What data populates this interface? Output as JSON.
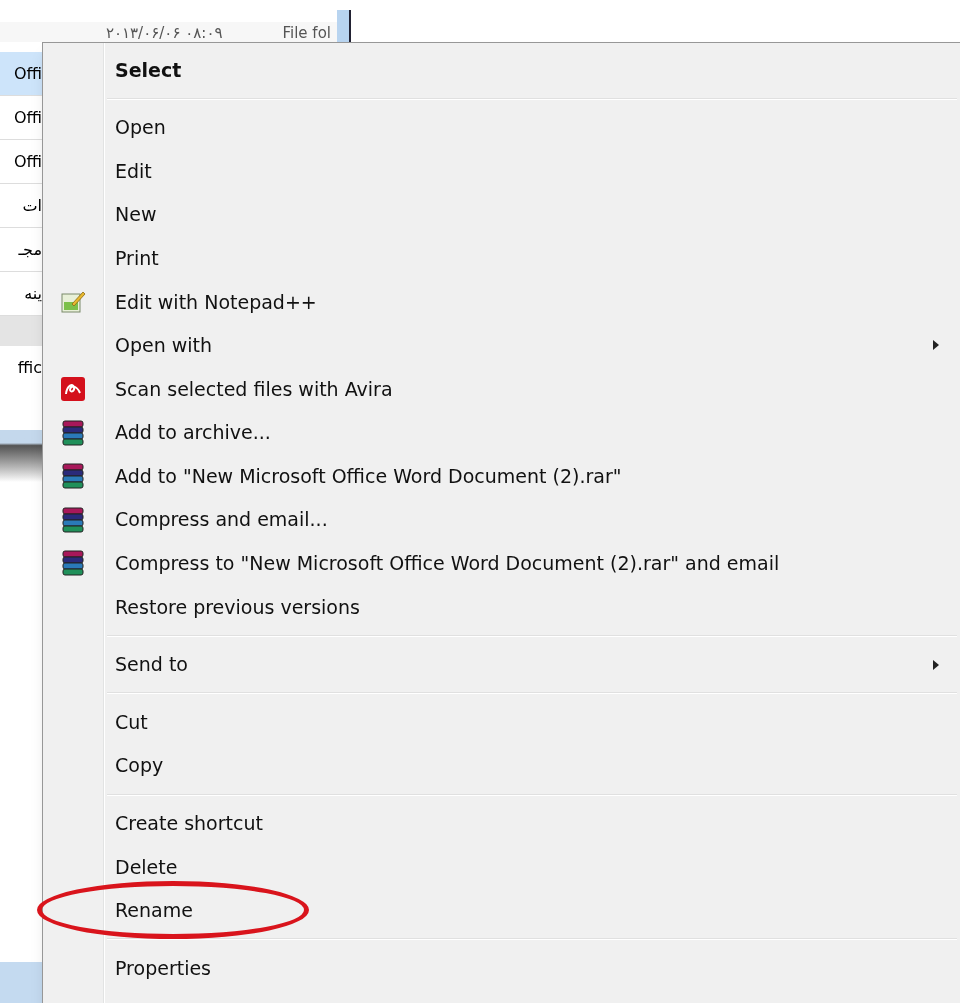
{
  "file_row": {
    "date": "۲۰۱۳/۰۶/۰۶ ۰۸:۰۹",
    "type": "File fol"
  },
  "left_items": [
    {
      "text": "Offi",
      "selected": true
    },
    {
      "text": "Offi",
      "selected": false
    },
    {
      "text": "Offi",
      "selected": false
    },
    {
      "text": "ات",
      "selected": false
    },
    {
      "text": "مجـ",
      "selected": false
    },
    {
      "text": "ينه",
      "selected": false
    }
  ],
  "lower_item": {
    "text": "ffic"
  },
  "menu": [
    {
      "kind": "item",
      "label": "Select",
      "default": true
    },
    {
      "kind": "separator"
    },
    {
      "kind": "item",
      "label": "Open"
    },
    {
      "kind": "item",
      "label": "Edit"
    },
    {
      "kind": "item",
      "label": "New"
    },
    {
      "kind": "item",
      "label": "Print"
    },
    {
      "kind": "notepad",
      "label": "Edit with Notepad++"
    },
    {
      "kind": "item",
      "label": "Open with",
      "submenu": true
    },
    {
      "kind": "avira",
      "label": "Scan selected files with Avira"
    },
    {
      "kind": "archive",
      "label": "Add to archive..."
    },
    {
      "kind": "archive",
      "label": "Add to \"New Microsoft Office Word Document (2).rar\""
    },
    {
      "kind": "archive",
      "label": "Compress and email..."
    },
    {
      "kind": "archive",
      "label": "Compress to \"New Microsoft Office Word Document (2).rar\" and email"
    },
    {
      "kind": "item",
      "label": "Restore previous versions"
    },
    {
      "kind": "separator"
    },
    {
      "kind": "item",
      "label": "Send to",
      "submenu": true
    },
    {
      "kind": "separator"
    },
    {
      "kind": "item",
      "label": "Cut"
    },
    {
      "kind": "item",
      "label": "Copy"
    },
    {
      "kind": "separator"
    },
    {
      "kind": "item",
      "label": "Create shortcut"
    },
    {
      "kind": "item",
      "label": "Delete"
    },
    {
      "kind": "item",
      "label": "Rename",
      "circled": true
    },
    {
      "kind": "separator"
    },
    {
      "kind": "item",
      "label": "Properties"
    }
  ]
}
